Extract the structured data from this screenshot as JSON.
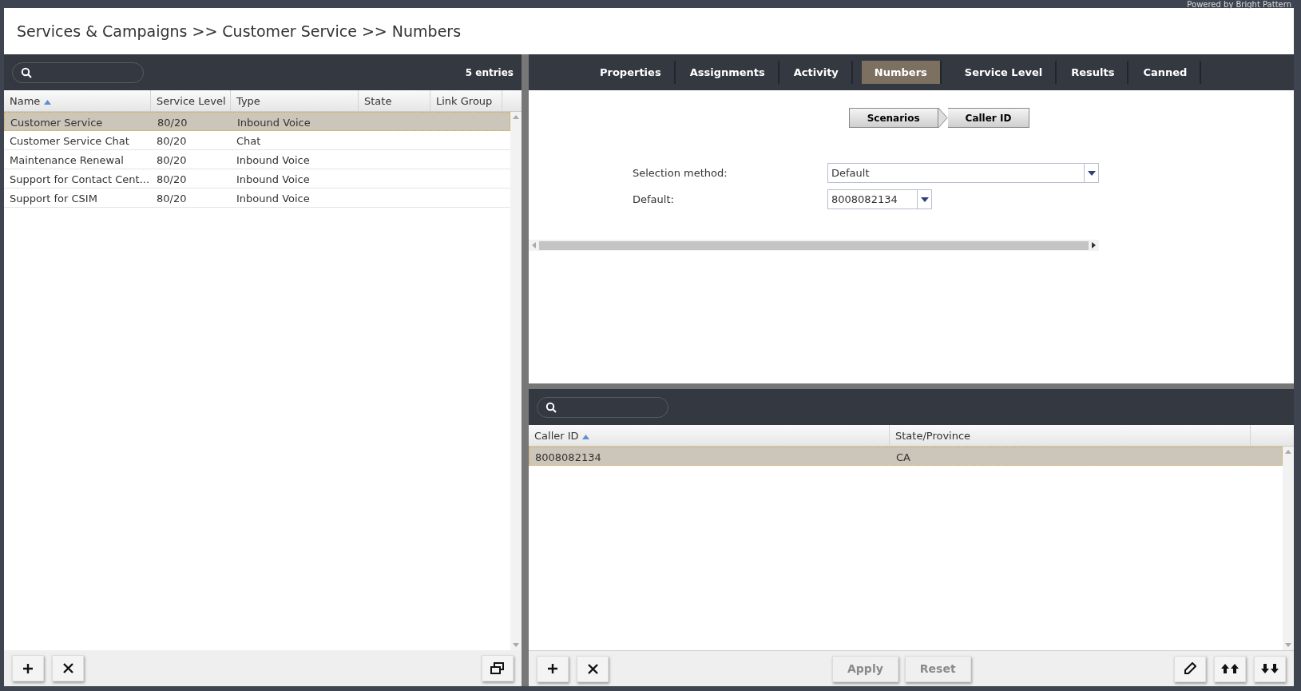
{
  "powered_by": "Powered by Bright Pattern",
  "breadcrumb": "Services & Campaigns >> Customer Service >> Numbers",
  "left": {
    "entries": "5 entries",
    "columns": [
      {
        "label": "Name",
        "sorted": true
      },
      {
        "label": "Service Level",
        "sorted": false
      },
      {
        "label": "Type",
        "sorted": false
      },
      {
        "label": "State",
        "sorted": false
      },
      {
        "label": "Link Group",
        "sorted": false
      }
    ],
    "rows": [
      {
        "cells": [
          "Customer Service",
          "80/20",
          "Inbound Voice",
          "",
          ""
        ],
        "selected": true
      },
      {
        "cells": [
          "Customer Service Chat",
          "80/20",
          "Chat",
          "",
          ""
        ],
        "selected": false
      },
      {
        "cells": [
          "Maintenance Renewal",
          "80/20",
          "Inbound Voice",
          "",
          ""
        ],
        "selected": false
      },
      {
        "cells": [
          "Support for Contact Cent...",
          "80/20",
          "Inbound Voice",
          "",
          ""
        ],
        "selected": false
      },
      {
        "cells": [
          "Support for CSIM",
          "80/20",
          "Inbound Voice",
          "",
          ""
        ],
        "selected": false
      }
    ]
  },
  "tabs": [
    {
      "label": "Properties",
      "selected": false
    },
    {
      "label": "Assignments",
      "selected": false
    },
    {
      "label": "Activity",
      "selected": false
    },
    {
      "label": "Numbers",
      "selected": true
    },
    {
      "label": "Service Level",
      "selected": false
    },
    {
      "label": "Results",
      "selected": false
    },
    {
      "label": "Canned",
      "selected": false
    }
  ],
  "steps": [
    {
      "label": "Scenarios"
    },
    {
      "label": "Caller ID"
    }
  ],
  "form": [
    {
      "label": "Selection method:",
      "value": "Default",
      "kind": "wide"
    },
    {
      "label": "Default:",
      "value": "8008082134",
      "kind": "narrow"
    }
  ],
  "caller_table": {
    "columns": [
      {
        "label": "Caller ID",
        "sorted": true
      },
      {
        "label": "State/Province",
        "sorted": false
      }
    ],
    "rows": [
      {
        "cells": [
          "8008082134",
          "CA"
        ],
        "selected": true
      }
    ]
  },
  "actions": [
    {
      "label": "Apply",
      "disabled": true
    },
    {
      "label": "Reset",
      "disabled": true
    }
  ]
}
